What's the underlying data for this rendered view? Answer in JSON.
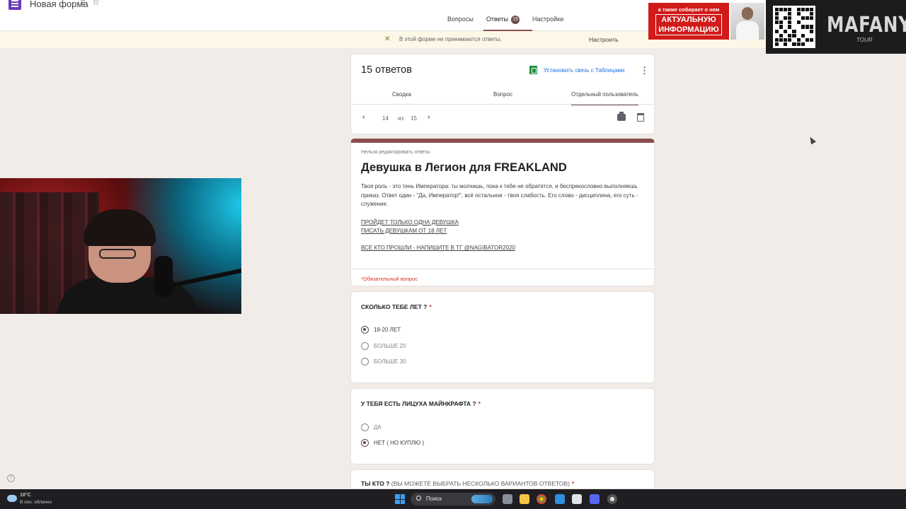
{
  "app": {
    "form_title": "Новая форма",
    "title_icons": [
      "folder-move-icon",
      "star-icon"
    ]
  },
  "top_tabs": {
    "questions": "Вопросы",
    "responses": "Ответы",
    "responses_count": "15",
    "settings": "Настройки"
  },
  "banner": {
    "text": "В этой форме не принимаются ответы.",
    "action": "Настроить"
  },
  "overlay": {
    "promo_top": "а также собирает о нем",
    "promo_main": "АКТУАЛЬНУЮ ИНФОРМАЦИЮ",
    "tour_name": "MAFANYA",
    "tour_sub": "TOUR"
  },
  "responses": {
    "count_title": "15 ответов",
    "sheets_link": "Установить связь с Таблицами",
    "tabs": [
      "Сводка",
      "Вопрос",
      "Отдельный пользователь"
    ],
    "active_tab": "Отдельный пользователь",
    "nav": {
      "current": "14",
      "of": "из",
      "total": "15"
    }
  },
  "form": {
    "noedit": "Нельзя редактировать ответы",
    "title": "Девушка в Легион для FREAKLAND",
    "description": "Твоя роль - это тень Императора: ты молчишь, пока к тебе не обратятся, и беспрекословно выполняешь приказ. Ответ один - \"Да, Император!\", всё остальное - твоя слабость. Его слово - дисциплина, его суть - служение.",
    "links": [
      "ПРОЙДЕТ ТОЛЬКО ОДНА ДЕВУШКА",
      "ПИСАТЬ ДЕВУШКАМ ОТ 18 ЛЕТ",
      "ВСЕ КТО ПРОШЛИ - НАПИШИТЕ В ТГ @NAGIBATOR2020"
    ],
    "required_note": "*Обязательный вопрос"
  },
  "questions": [
    {
      "title": "СКОЛЬКО ТЕБЕ ЛЕТ ?",
      "required": "*",
      "options": [
        {
          "label": "18-20 ЛЕТ",
          "selected": true
        },
        {
          "label": "БОЛЬШЕ 20",
          "selected": false
        },
        {
          "label": "БОЛЬШЕ 30",
          "selected": false
        }
      ]
    },
    {
      "title": "У ТЕБЯ ЕСТЬ ЛИЦУХА МАЙНКРАФТА ?",
      "required": "*",
      "options": [
        {
          "label": "ДА",
          "selected": false
        },
        {
          "label": "НЕТ ( НО КУПЛЮ )",
          "selected": true
        }
      ]
    },
    {
      "title": "ТЫ КТО ?",
      "hint": "(ВЫ МОЖЕТЕ ВЫБРАТЬ НЕСКОЛЬКО ВАРИАНТОВ ОТВЕТОВ)",
      "required": "*"
    }
  ],
  "taskbar": {
    "temp": "18°C",
    "weather": "В осн. облачно",
    "search": "Поиск"
  },
  "colors": {
    "accent": "#8d4e4e",
    "banner": "#fcf7e6",
    "link": "#1a73e8",
    "required": "#d93025",
    "background": "#f1ece7"
  }
}
